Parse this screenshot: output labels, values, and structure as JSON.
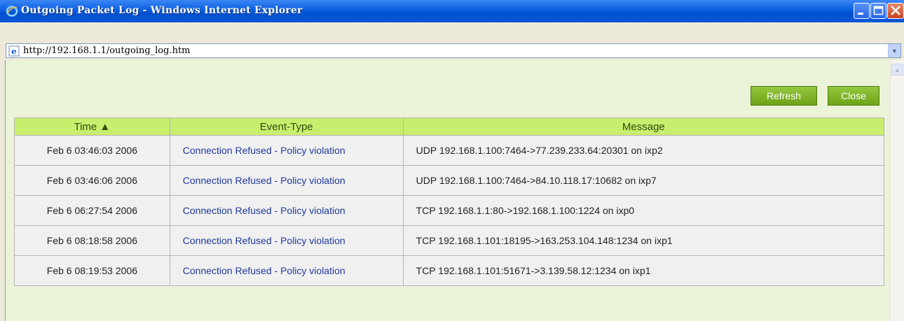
{
  "window": {
    "title": "Outgoing Packet Log - Windows Internet Explorer"
  },
  "address": {
    "url": "http://192.168.1.1/outgoing_log.htm"
  },
  "toolbar": {
    "refresh_label": "Refresh",
    "close_label": "Close"
  },
  "table": {
    "headers": {
      "time": "Time ▲",
      "event_type": "Event-Type",
      "message": "Message"
    },
    "rows": [
      {
        "time": "Feb 6 03:46:03 2006",
        "event_type": "Connection Refused - Policy violation",
        "message": "UDP 192.168.1.100:7464->77.239.233.64:20301 on ixp2"
      },
      {
        "time": "Feb 6 03:46:06 2006",
        "event_type": "Connection Refused - Policy violation",
        "message": "UDP 192.168.1.100:7464->84.10.118.17:10682 on ixp7"
      },
      {
        "time": "Feb 6 06:27:54 2006",
        "event_type": "Connection Refused - Policy violation",
        "message": "TCP 192.168.1.1:80->192.168.1.100:1224 on ixp0"
      },
      {
        "time": "Feb 6 08:18:58 2006",
        "event_type": "Connection Refused - Policy violation",
        "message": "TCP 192.168.1.101:18195->163.253.104.148:1234 on ixp1"
      },
      {
        "time": "Feb 6 08:19:53 2006",
        "event_type": "Connection Refused - Policy violation",
        "message": "TCP 192.168.1.101:51671->3.139.58.12:1234 on ixp1"
      }
    ]
  },
  "icons": {
    "title": "ie-logo-icon",
    "address": "ie-page-icon",
    "minimize": "minimize-icon",
    "maximize": "maximize-icon",
    "close": "close-icon"
  },
  "colors": {
    "titlebar": "#0a5fe0",
    "panel_background": "#ebf4d8",
    "table_header": "#c8ee6e",
    "button_green": "#7fb22a",
    "event_link": "#1f3a9c"
  }
}
